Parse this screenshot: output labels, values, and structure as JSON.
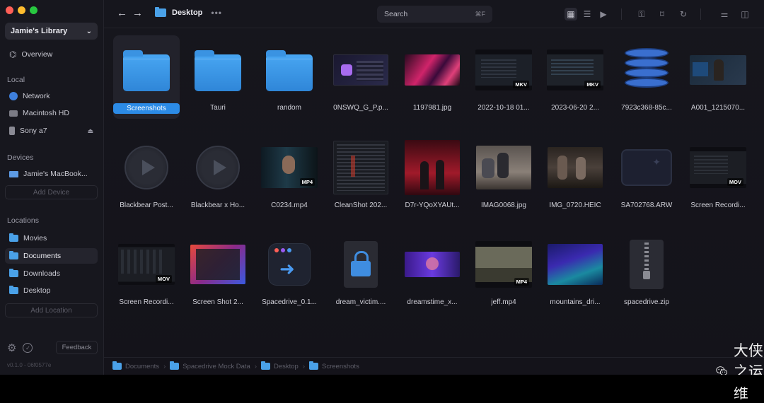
{
  "sidebar": {
    "library": "Jamie's Library",
    "overview": "Overview",
    "local_head": "Local",
    "local": [
      "Network",
      "Macintosh HD",
      "Sony a7"
    ],
    "devices_head": "Devices",
    "device": "Jamie's MacBook...",
    "add_device": "Add Device",
    "locations_head": "Locations",
    "locations": [
      "Movies",
      "Documents",
      "Downloads",
      "Desktop"
    ],
    "add_location": "Add Location",
    "feedback": "Feedback",
    "version": "v0.1.0 - 06f0577e"
  },
  "topbar": {
    "title": "Desktop",
    "dots": "•••",
    "search_placeholder": "Search",
    "search_shortcut": "⌘F"
  },
  "files": [
    {
      "name": "Screenshots",
      "kind": "folder"
    },
    {
      "name": "Tauri",
      "kind": "folder"
    },
    {
      "name": "random",
      "kind": "folder"
    },
    {
      "name": "0NSWQ_G_P.p...",
      "kind": "image"
    },
    {
      "name": "1197981.jpg",
      "kind": "image"
    },
    {
      "name": "2022-10-18 01...",
      "kind": "video",
      "badge": "MKV"
    },
    {
      "name": "2023-06-20 2...",
      "kind": "video",
      "badge": "MKV"
    },
    {
      "name": "7923c368-85c...",
      "kind": "database"
    },
    {
      "name": "A001_1215070...",
      "kind": "image"
    },
    {
      "name": "Blackbear Post...",
      "kind": "audio"
    },
    {
      "name": "Blackbear x Ho...",
      "kind": "audio"
    },
    {
      "name": "C0234.mp4",
      "kind": "video",
      "badge": "MP4"
    },
    {
      "name": "CleanShot 202...",
      "kind": "image"
    },
    {
      "name": "D7r-YQoXYAUt...",
      "kind": "image"
    },
    {
      "name": "IMAG0068.jpg",
      "kind": "image"
    },
    {
      "name": "IMG_0720.HEIC",
      "kind": "image"
    },
    {
      "name": "SA702768.ARW",
      "kind": "raw"
    },
    {
      "name": "Screen Recordi...",
      "kind": "video",
      "badge": "MOV"
    },
    {
      "name": "Screen Recordi...",
      "kind": "video",
      "badge": "MOV"
    },
    {
      "name": "Screen Shot 2...",
      "kind": "image"
    },
    {
      "name": "Spacedrive_0.1...",
      "kind": "app"
    },
    {
      "name": "dream_victim....",
      "kind": "locked"
    },
    {
      "name": "dreamstime_x...",
      "kind": "image"
    },
    {
      "name": "jeff.mp4",
      "kind": "video",
      "badge": "MP4"
    },
    {
      "name": "mountains_dri...",
      "kind": "image"
    },
    {
      "name": "spacedrive.zip",
      "kind": "zip"
    }
  ],
  "pathbar": [
    "Documents",
    "Spacedrive Mock Data",
    "Desktop",
    "Screenshots"
  ],
  "watermark": "大侠之运维",
  "colors": {
    "accent": "#2c8be6",
    "folder": "#3a93e2",
    "bg": "#121219"
  }
}
